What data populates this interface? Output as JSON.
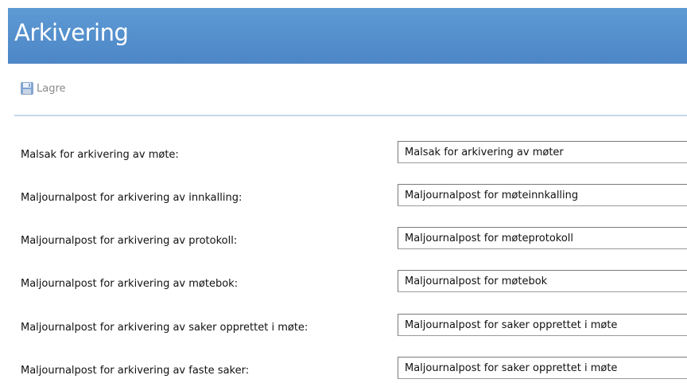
{
  "header": {
    "title": "Arkivering"
  },
  "toolbar": {
    "save_icon": "save-icon",
    "save_label": "Lagre"
  },
  "form": {
    "rows": [
      {
        "label": "Malsak for arkivering av møte:",
        "value": "Malsak for arkivering av møter"
      },
      {
        "label": "Maljournalpost for arkivering av innkalling:",
        "value": "Maljournalpost for møteinnkalling"
      },
      {
        "label": "Maljournalpost for arkivering av protokoll:",
        "value": "Maljournalpost for møteprotokoll"
      },
      {
        "label": "Maljournalpost for arkivering av møtebok:",
        "value": "Maljournalpost for møtebok"
      },
      {
        "label": "Maljournalpost for arkivering av saker opprettet i møte:",
        "value": "Maljournalpost for saker opprettet i møte"
      },
      {
        "label": "Maljournalpost for arkivering av faste saker:",
        "value": "Maljournalpost for saker opprettet i møte"
      }
    ]
  }
}
